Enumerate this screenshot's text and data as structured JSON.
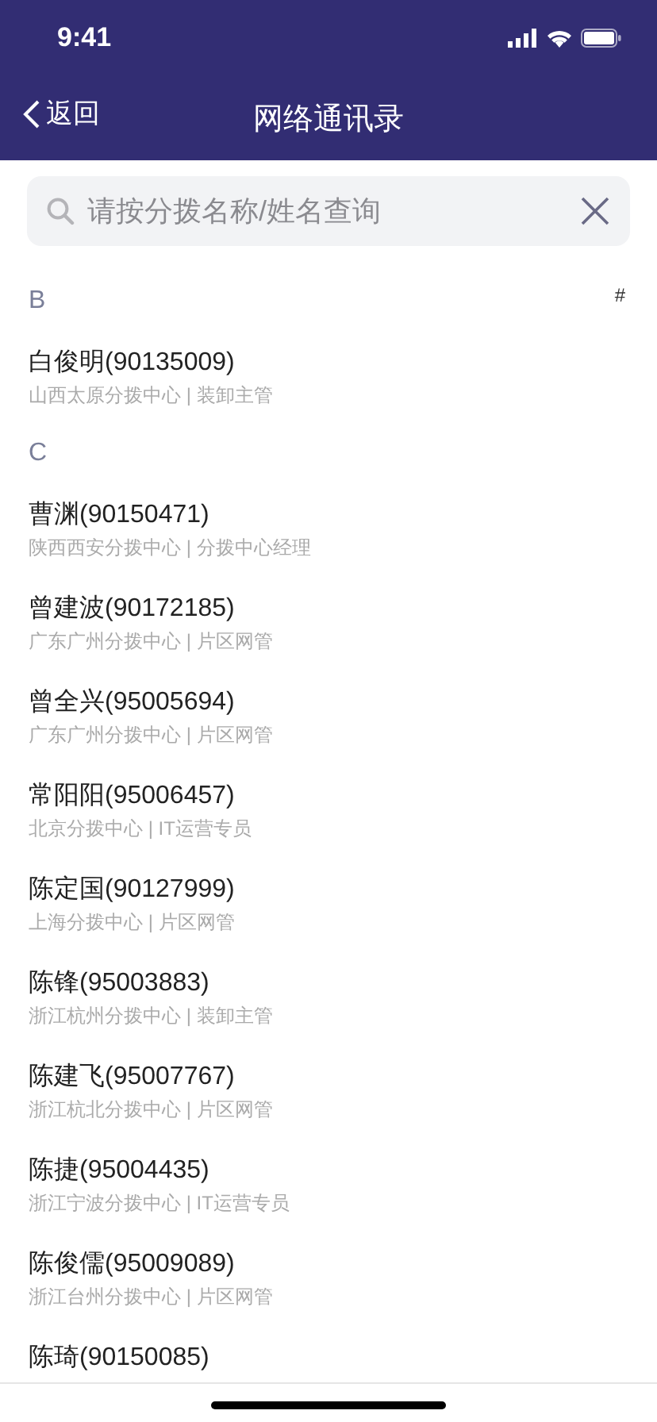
{
  "status_bar": {
    "time": "9:41"
  },
  "nav": {
    "back": "返回",
    "title": "网络通讯录"
  },
  "search": {
    "placeholder": "请按分拨名称/姓名查询"
  },
  "index_bar": [
    "#"
  ],
  "sections": [
    {
      "letter": "B",
      "contacts": [
        {
          "name": "白俊明(90135009)",
          "detail": "山西太原分拨中心 | 装卸主管"
        }
      ]
    },
    {
      "letter": "C",
      "contacts": [
        {
          "name": "曹渊(90150471)",
          "detail": "陕西西安分拨中心 | 分拨中心经理"
        },
        {
          "name": "曾建波(90172185)",
          "detail": "广东广州分拨中心 | 片区网管"
        },
        {
          "name": "曾全兴(95005694)",
          "detail": "广东广州分拨中心 | 片区网管"
        },
        {
          "name": "常阳阳(95006457)",
          "detail": "北京分拨中心 | IT运营专员"
        },
        {
          "name": "陈定国(90127999)",
          "detail": "上海分拨中心 | 片区网管"
        },
        {
          "name": "陈锋(95003883)",
          "detail": "浙江杭州分拨中心 | 装卸主管"
        },
        {
          "name": "陈建飞(95007767)",
          "detail": "浙江杭北分拨中心 | 片区网管"
        },
        {
          "name": "陈捷(95004435)",
          "detail": "浙江宁波分拨中心 | IT运营专员"
        },
        {
          "name": "陈俊儒(95009089)",
          "detail": "浙江台州分拨中心 | 片区网管"
        },
        {
          "name": "陈琦(90150085)"
        }
      ]
    }
  ]
}
